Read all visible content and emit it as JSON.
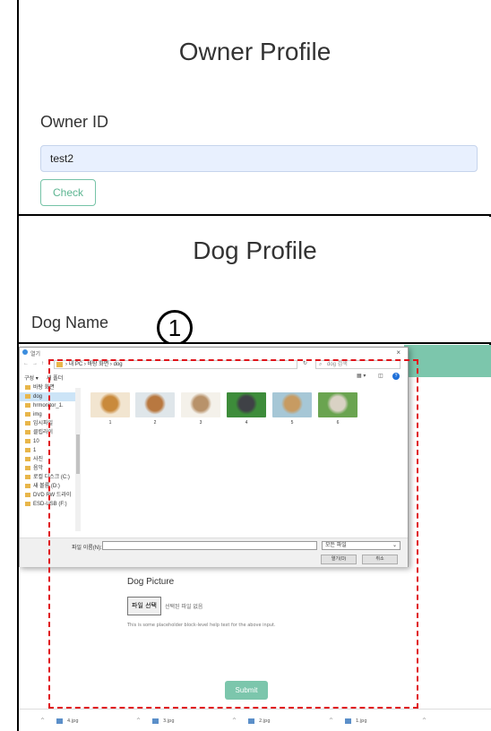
{
  "owner_profile": {
    "title": "Owner Profile",
    "id_label": "Owner ID",
    "id_value": "test2",
    "check_label": "Check"
  },
  "dog_profile": {
    "title": "Dog Profile",
    "name_label": "Dog Name",
    "step_number": "1"
  },
  "file_dialog": {
    "title_glyph": "열기",
    "close_glyph": "×",
    "address_path": "› 내 PC › 바탕 화면 › dog",
    "refresh_glyph": "↻",
    "search_placeholder": "dog 검색",
    "toolbar_organize": "구성 ▾",
    "toolbar_new_folder": "새 폴더",
    "toolbar_view_glyph": "▦ ▾",
    "toolbar_pane_glyph": "◫",
    "toolbar_help_glyph": "?",
    "nav_items": [
      "바탕 화면",
      "dog",
      "hrmonitor_1.",
      "img",
      "임시파일",
      "클립라이",
      "10",
      "1",
      "사진",
      "음악",
      "로컬 디스크 (C:)",
      "새 볼륨 (D:)",
      "DVD RW 드라이",
      "ESD-USB (F:)"
    ],
    "files": [
      {
        "name": "1",
        "color1": "#c98a3c",
        "color2": "#f2e5d0"
      },
      {
        "name": "2",
        "color1": "#b87840",
        "color2": "#dfe6ea"
      },
      {
        "name": "3",
        "color1": "#b8926a",
        "color2": "#f4f1ea"
      },
      {
        "name": "4",
        "color1": "#3f4146",
        "color2": "#3d8c3a"
      },
      {
        "name": "5",
        "color1": "#c79b62",
        "color2": "#a6c7d6"
      },
      {
        "name": "6",
        "color1": "#d9d2c4",
        "color2": "#6aa450"
      }
    ],
    "filename_label": "파일 이름(N):",
    "filetype_value": "모든 파일",
    "open_label": "열기(O)",
    "cancel_label": "취소"
  },
  "upload_form": {
    "picture_label": "Dog Picture",
    "choose_file_label": "파일 선택",
    "no_file_text": "선택된 파일 없음",
    "help_text": "This is some placeholder block-level help text for the above input.",
    "submit_label": "Submit"
  },
  "downloads": [
    {
      "name": "4.jpg"
    },
    {
      "name": "3.jpg"
    },
    {
      "name": "2.jpg"
    },
    {
      "name": "1.jpg"
    }
  ],
  "colors": {
    "accent_green": "#7cc6ac",
    "annotation_red": "#e0141b",
    "input_blue": "#e8f0fe"
  }
}
